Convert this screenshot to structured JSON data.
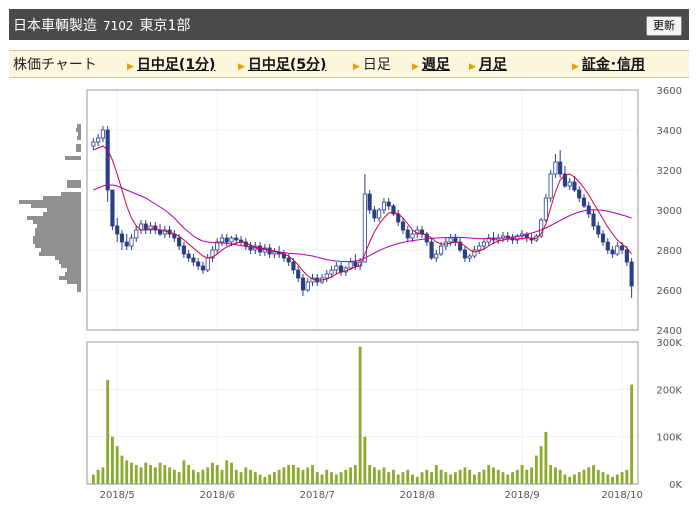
{
  "header": {
    "company": "日本車輌製造",
    "code": "7102",
    "market": "東京1部",
    "refresh_label": "更新"
  },
  "nav": {
    "title": "株価チャート",
    "items": [
      {
        "label": "日中足(1分)",
        "link": true
      },
      {
        "label": "日中足(5分)",
        "link": true
      },
      {
        "label": "日足",
        "link": false
      },
      {
        "label": "週足",
        "link": true
      },
      {
        "label": "月足",
        "link": true
      },
      {
        "label": "証金･信用",
        "link": true
      }
    ]
  },
  "colors": {
    "bar": "#5c6f9c",
    "up_fill": "#ffffff",
    "candle": "#2b3f87",
    "ma_short": "#d2003c",
    "ma_long": "#b400b4",
    "volume": "#8aab2e",
    "profile": "#909090"
  },
  "chart_data": {
    "type": "candlestick",
    "price_axis": {
      "min": 2400,
      "max": 3600,
      "ticks": [
        2400,
        2600,
        2800,
        3000,
        3200,
        3400,
        3600
      ]
    },
    "volume_axis": {
      "min": 0,
      "max": 300000,
      "ticks": [
        0,
        100000,
        200000,
        300000
      ],
      "tick_labels": [
        "0K",
        "100K",
        "200K",
        "300K"
      ]
    },
    "x_labels": [
      {
        "label": "2018/5",
        "index": 5
      },
      {
        "label": "2018/6",
        "index": 26
      },
      {
        "label": "2018/7",
        "index": 47
      },
      {
        "label": "2018/8",
        "index": 68
      },
      {
        "label": "2018/9",
        "index": 90
      },
      {
        "label": "2018/10",
        "index": 111
      }
    ],
    "ohlc": [
      [
        3320,
        3360,
        3300,
        3340
      ],
      [
        3340,
        3380,
        3320,
        3360
      ],
      [
        3360,
        3420,
        3340,
        3400
      ],
      [
        3400,
        3420,
        3040,
        3100
      ],
      [
        3100,
        3100,
        2900,
        2920
      ],
      [
        2920,
        2960,
        2840,
        2880
      ],
      [
        2880,
        2900,
        2800,
        2840
      ],
      [
        2840,
        2880,
        2800,
        2820
      ],
      [
        2820,
        2880,
        2800,
        2860
      ],
      [
        2860,
        2920,
        2840,
        2900
      ],
      [
        2900,
        2950,
        2880,
        2930
      ],
      [
        2930,
        2950,
        2880,
        2900
      ],
      [
        2900,
        2940,
        2880,
        2920
      ],
      [
        2920,
        2940,
        2880,
        2900
      ],
      [
        2900,
        2930,
        2870,
        2880
      ],
      [
        2880,
        2920,
        2860,
        2900
      ],
      [
        2900,
        2920,
        2860,
        2880
      ],
      [
        2880,
        2900,
        2840,
        2860
      ],
      [
        2860,
        2880,
        2800,
        2820
      ],
      [
        2820,
        2840,
        2760,
        2780
      ],
      [
        2780,
        2800,
        2740,
        2760
      ],
      [
        2760,
        2780,
        2720,
        2740
      ],
      [
        2740,
        2760,
        2700,
        2720
      ],
      [
        2720,
        2740,
        2680,
        2700
      ],
      [
        2700,
        2780,
        2690,
        2760
      ],
      [
        2760,
        2820,
        2740,
        2800
      ],
      [
        2800,
        2860,
        2780,
        2840
      ],
      [
        2840,
        2880,
        2820,
        2860
      ],
      [
        2860,
        2880,
        2820,
        2840
      ],
      [
        2840,
        2870,
        2820,
        2860
      ],
      [
        2860,
        2880,
        2830,
        2850
      ],
      [
        2850,
        2870,
        2820,
        2840
      ],
      [
        2840,
        2860,
        2800,
        2820
      ],
      [
        2820,
        2840,
        2780,
        2800
      ],
      [
        2800,
        2840,
        2780,
        2820
      ],
      [
        2820,
        2840,
        2770,
        2790
      ],
      [
        2790,
        2830,
        2770,
        2810
      ],
      [
        2810,
        2830,
        2760,
        2780
      ],
      [
        2780,
        2810,
        2760,
        2790
      ],
      [
        2790,
        2820,
        2760,
        2780
      ],
      [
        2780,
        2800,
        2740,
        2760
      ],
      [
        2760,
        2780,
        2720,
        2740
      ],
      [
        2740,
        2760,
        2680,
        2700
      ],
      [
        2700,
        2720,
        2640,
        2660
      ],
      [
        2660,
        2680,
        2570,
        2600
      ],
      [
        2600,
        2660,
        2590,
        2640
      ],
      [
        2640,
        2680,
        2620,
        2660
      ],
      [
        2660,
        2680,
        2620,
        2640
      ],
      [
        2640,
        2680,
        2630,
        2660
      ],
      [
        2660,
        2700,
        2640,
        2680
      ],
      [
        2680,
        2720,
        2660,
        2700
      ],
      [
        2700,
        2740,
        2680,
        2720
      ],
      [
        2720,
        2740,
        2670,
        2690
      ],
      [
        2690,
        2720,
        2670,
        2710
      ],
      [
        2710,
        2760,
        2700,
        2740
      ],
      [
        2740,
        2780,
        2700,
        2720
      ],
      [
        2720,
        2760,
        2700,
        2740
      ],
      [
        2740,
        3180,
        2740,
        3080
      ],
      [
        3080,
        3100,
        2980,
        3000
      ],
      [
        3000,
        3020,
        2940,
        2960
      ],
      [
        2960,
        3010,
        2940,
        3000
      ],
      [
        3000,
        3060,
        2980,
        3040
      ],
      [
        3040,
        3060,
        3000,
        3020
      ],
      [
        3020,
        3030,
        2970,
        2980
      ],
      [
        2980,
        3000,
        2920,
        2940
      ],
      [
        2940,
        2960,
        2880,
        2900
      ],
      [
        2900,
        2920,
        2840,
        2860
      ],
      [
        2860,
        2900,
        2840,
        2880
      ],
      [
        2880,
        2920,
        2860,
        2900
      ],
      [
        2900,
        2920,
        2860,
        2880
      ],
      [
        2880,
        2890,
        2820,
        2840
      ],
      [
        2840,
        2860,
        2750,
        2760
      ],
      [
        2760,
        2800,
        2740,
        2780
      ],
      [
        2780,
        2840,
        2770,
        2820
      ],
      [
        2820,
        2860,
        2800,
        2840
      ],
      [
        2840,
        2880,
        2820,
        2860
      ],
      [
        2860,
        2880,
        2820,
        2840
      ],
      [
        2840,
        2860,
        2790,
        2800
      ],
      [
        2800,
        2820,
        2740,
        2760
      ],
      [
        2760,
        2780,
        2740,
        2770
      ],
      [
        2770,
        2820,
        2760,
        2800
      ],
      [
        2800,
        2840,
        2780,
        2820
      ],
      [
        2820,
        2860,
        2800,
        2840
      ],
      [
        2840,
        2880,
        2820,
        2860
      ],
      [
        2860,
        2890,
        2830,
        2850
      ],
      [
        2850,
        2880,
        2830,
        2860
      ],
      [
        2860,
        2890,
        2840,
        2870
      ],
      [
        2870,
        2890,
        2840,
        2860
      ],
      [
        2860,
        2880,
        2830,
        2850
      ],
      [
        2850,
        2880,
        2830,
        2870
      ],
      [
        2870,
        2900,
        2850,
        2880
      ],
      [
        2880,
        2890,
        2840,
        2860
      ],
      [
        2860,
        2880,
        2830,
        2850
      ],
      [
        2850,
        2880,
        2840,
        2870
      ],
      [
        2870,
        2960,
        2860,
        2950
      ],
      [
        2950,
        3080,
        2940,
        3060
      ],
      [
        3060,
        3200,
        3040,
        3180
      ],
      [
        3180,
        3280,
        3160,
        3240
      ],
      [
        3240,
        3300,
        3160,
        3180
      ],
      [
        3180,
        3220,
        3110,
        3120
      ],
      [
        3120,
        3160,
        3100,
        3140
      ],
      [
        3140,
        3170,
        3090,
        3100
      ],
      [
        3100,
        3120,
        3040,
        3060
      ],
      [
        3060,
        3080,
        3010,
        3020
      ],
      [
        3020,
        3040,
        2960,
        2980
      ],
      [
        2980,
        3000,
        2900,
        2920
      ],
      [
        2920,
        2940,
        2860,
        2880
      ],
      [
        2880,
        2900,
        2820,
        2840
      ],
      [
        2840,
        2860,
        2780,
        2800
      ],
      [
        2800,
        2820,
        2760,
        2780
      ],
      [
        2780,
        2840,
        2770,
        2820
      ],
      [
        2820,
        2840,
        2780,
        2800
      ],
      [
        2800,
        2820,
        2720,
        2740
      ],
      [
        2740,
        2760,
        2560,
        2620
      ]
    ],
    "ma_short": [
      3300,
      3310,
      3320,
      3300,
      3250,
      3180,
      3100,
      3020,
      2960,
      2920,
      2900,
      2900,
      2905,
      2905,
      2900,
      2895,
      2890,
      2880,
      2870,
      2850,
      2830,
      2810,
      2790,
      2770,
      2760,
      2765,
      2780,
      2800,
      2815,
      2825,
      2835,
      2840,
      2835,
      2825,
      2815,
      2810,
      2805,
      2800,
      2795,
      2790,
      2780,
      2770,
      2750,
      2725,
      2695,
      2670,
      2655,
      2650,
      2650,
      2655,
      2665,
      2680,
      2690,
      2695,
      2705,
      2715,
      2720,
      2780,
      2840,
      2890,
      2930,
      2960,
      2985,
      2990,
      2980,
      2960,
      2930,
      2900,
      2885,
      2880,
      2875,
      2860,
      2840,
      2830,
      2830,
      2835,
      2840,
      2835,
      2820,
      2800,
      2790,
      2795,
      2805,
      2820,
      2835,
      2845,
      2850,
      2855,
      2855,
      2855,
      2858,
      2860,
      2860,
      2858,
      2880,
      2930,
      3010,
      3090,
      3150,
      3175,
      3180,
      3165,
      3140,
      3110,
      3075,
      3035,
      2995,
      2955,
      2915,
      2880,
      2850,
      2830,
      2810,
      2780
    ],
    "ma_long": [
      3100,
      3110,
      3120,
      3125,
      3125,
      3120,
      3110,
      3100,
      3090,
      3080,
      3070,
      3060,
      3045,
      3030,
      3015,
      3000,
      2980,
      2960,
      2935,
      2910,
      2890,
      2870,
      2855,
      2845,
      2840,
      2838,
      2836,
      2835,
      2833,
      2830,
      2826,
      2822,
      2818,
      2814,
      2810,
      2806,
      2802,
      2798,
      2794,
      2790,
      2787,
      2784,
      2782,
      2780,
      2778,
      2774,
      2770,
      2764,
      2758,
      2752,
      2748,
      2745,
      2743,
      2742,
      2742,
      2745,
      2750,
      2760,
      2772,
      2785,
      2797,
      2808,
      2817,
      2825,
      2832,
      2838,
      2843,
      2847,
      2850,
      2853,
      2856,
      2858,
      2860,
      2861,
      2862,
      2863,
      2864,
      2863,
      2862,
      2860,
      2858,
      2857,
      2856,
      2857,
      2858,
      2859,
      2860,
      2862,
      2865,
      2868,
      2872,
      2878,
      2885,
      2892,
      2900,
      2910,
      2922,
      2935,
      2948,
      2960,
      2972,
      2982,
      2990,
      2996,
      3000,
      3001,
      3000,
      2998,
      2994,
      2988,
      2982,
      2975,
      2968,
      2960
    ],
    "volume": [
      20000,
      30000,
      35000,
      220000,
      100000,
      80000,
      60000,
      50000,
      45000,
      40000,
      35000,
      45000,
      40000,
      35000,
      45000,
      40000,
      35000,
      30000,
      25000,
      50000,
      40000,
      30000,
      25000,
      30000,
      35000,
      45000,
      40000,
      30000,
      50000,
      45000,
      30000,
      25000,
      35000,
      30000,
      25000,
      20000,
      15000,
      20000,
      25000,
      30000,
      35000,
      40000,
      40000,
      35000,
      30000,
      35000,
      40000,
      25000,
      20000,
      30000,
      25000,
      20000,
      25000,
      30000,
      35000,
      40000,
      290000,
      100000,
      40000,
      35000,
      30000,
      35000,
      25000,
      30000,
      20000,
      25000,
      30000,
      20000,
      15000,
      25000,
      30000,
      25000,
      40000,
      30000,
      25000,
      20000,
      25000,
      30000,
      35000,
      30000,
      20000,
      25000,
      30000,
      40000,
      35000,
      30000,
      25000,
      20000,
      25000,
      30000,
      40000,
      30000,
      35000,
      60000,
      80000,
      110000,
      40000,
      35000,
      30000,
      20000,
      15000,
      20000,
      25000,
      30000,
      35000,
      40000,
      30000,
      25000,
      20000,
      15000,
      20000,
      25000,
      30000,
      210000
    ],
    "volume_profile": [
      {
        "price": 3420,
        "size": 4
      },
      {
        "price": 3400,
        "size": 5
      },
      {
        "price": 3380,
        "size": 3
      },
      {
        "price": 3360,
        "size": 4
      },
      {
        "price": 3320,
        "size": 5
      },
      {
        "price": 3300,
        "size": 5
      },
      {
        "price": 3260,
        "size": 16
      },
      {
        "price": 3140,
        "size": 14
      },
      {
        "price": 3120,
        "size": 14
      },
      {
        "price": 3080,
        "size": 20
      },
      {
        "price": 3060,
        "size": 38
      },
      {
        "price": 3040,
        "size": 62
      },
      {
        "price": 3020,
        "size": 50
      },
      {
        "price": 3000,
        "size": 34
      },
      {
        "price": 2980,
        "size": 38
      },
      {
        "price": 2960,
        "size": 54
      },
      {
        "price": 2940,
        "size": 48
      },
      {
        "price": 2920,
        "size": 44
      },
      {
        "price": 2900,
        "size": 46
      },
      {
        "price": 2880,
        "size": 46
      },
      {
        "price": 2860,
        "size": 48
      },
      {
        "price": 2840,
        "size": 48
      },
      {
        "price": 2820,
        "size": 46
      },
      {
        "price": 2800,
        "size": 40
      },
      {
        "price": 2780,
        "size": 42
      },
      {
        "price": 2760,
        "size": 26
      },
      {
        "price": 2740,
        "size": 22
      },
      {
        "price": 2720,
        "size": 20
      },
      {
        "price": 2700,
        "size": 14
      },
      {
        "price": 2680,
        "size": 16
      },
      {
        "price": 2660,
        "size": 22
      },
      {
        "price": 2640,
        "size": 14
      },
      {
        "price": 2620,
        "size": 4
      },
      {
        "price": 2600,
        "size": 4
      }
    ]
  }
}
